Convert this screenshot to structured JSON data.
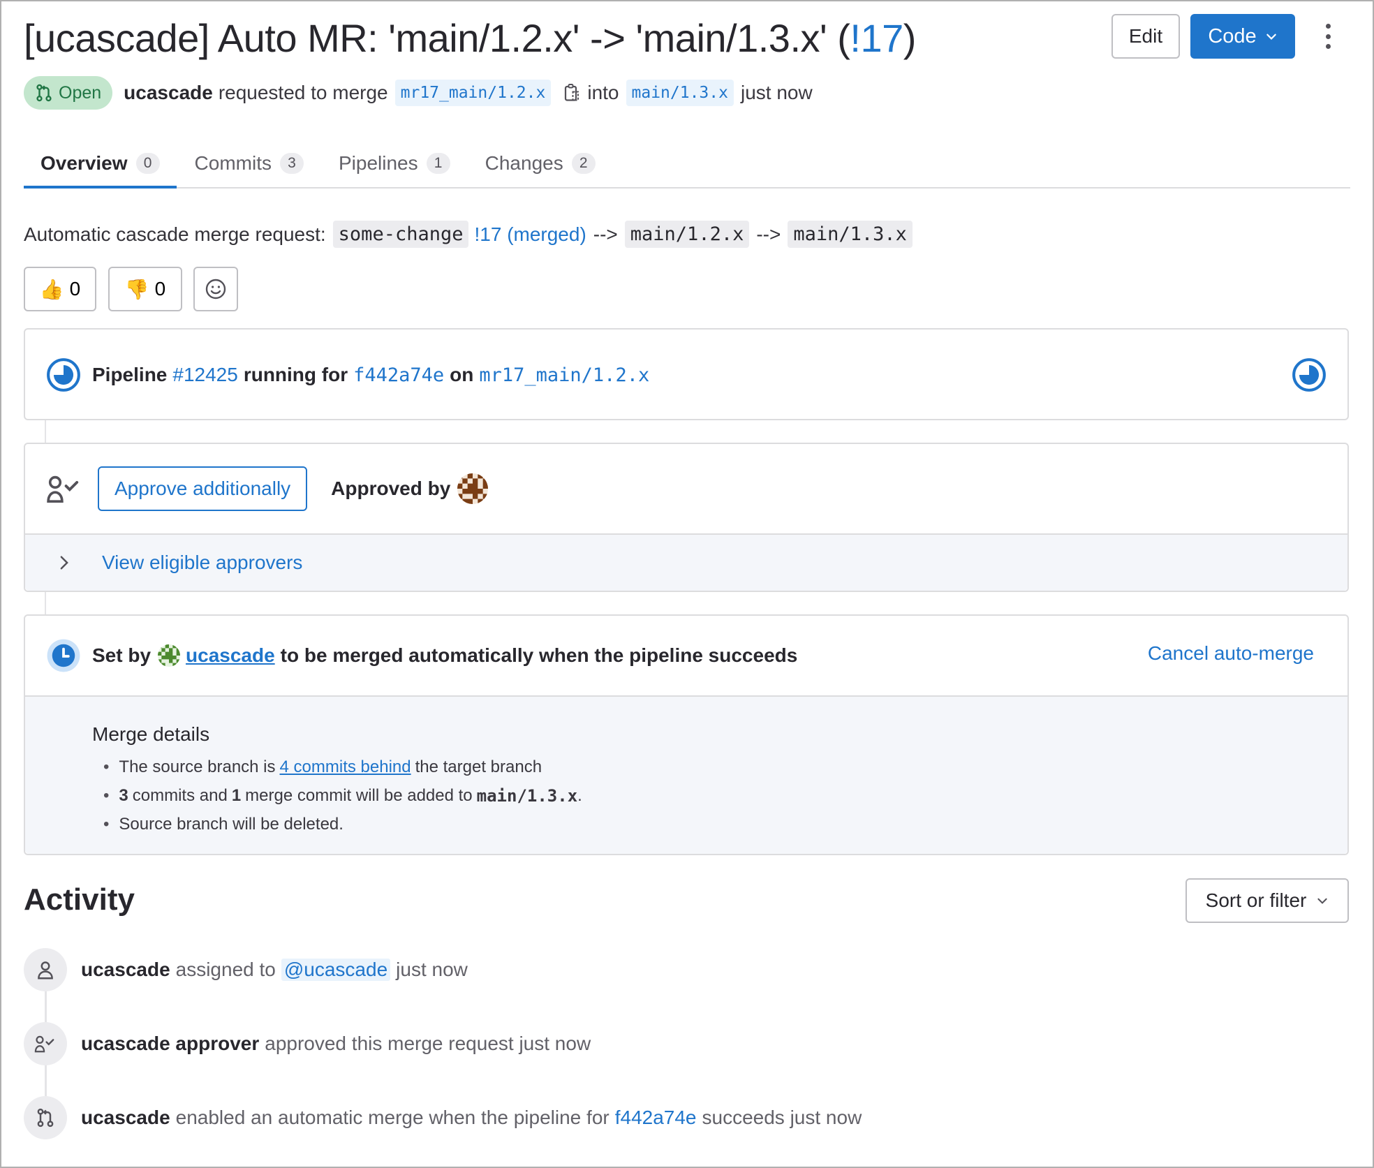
{
  "header": {
    "title_prefix": "[ucascade] Auto MR: 'main/1.2.x' -> 'main/1.3.x' (",
    "mr_number": "!17",
    "title_suffix": ")",
    "edit_label": "Edit",
    "code_label": "Code"
  },
  "meta": {
    "status": "Open",
    "author": "ucascade",
    "text_requested": "requested to merge",
    "source_branch": "mr17_main/1.2.x",
    "text_into": "into",
    "target_branch": "main/1.3.x",
    "time": "just now"
  },
  "tabs": [
    {
      "label": "Overview",
      "count": "0"
    },
    {
      "label": "Commits",
      "count": "3"
    },
    {
      "label": "Pipelines",
      "count": "1"
    },
    {
      "label": "Changes",
      "count": "2"
    }
  ],
  "description": {
    "prefix": "Automatic cascade merge request:",
    "code1": "some-change",
    "link": "!17 (merged)",
    "arrow1": "-->",
    "code2": "main/1.2.x",
    "arrow2": "-->",
    "code3": "main/1.3.x"
  },
  "reactions": {
    "thumbs_up": "0",
    "thumbs_down": "0"
  },
  "pipeline": {
    "label": "Pipeline",
    "id": "#12425",
    "running_for": "running for",
    "sha": "f442a74e",
    "on": "on",
    "branch": "mr17_main/1.2.x"
  },
  "approvals": {
    "approve_button": "Approve additionally",
    "approved_by": "Approved by",
    "view_eligible": "View eligible approvers"
  },
  "auto_merge": {
    "set_by": "Set by",
    "user": "ucascade",
    "message": "to be merged automatically when the pipeline succeeds",
    "cancel": "Cancel auto-merge",
    "details_title": "Merge details",
    "d1_prefix": "The source branch is",
    "d1_link": "4 commits behind",
    "d1_suffix": "the target branch",
    "d2_commits": "3",
    "d2_text1": "commits and",
    "d2_merge": "1",
    "d2_text2": "merge commit will be added to",
    "d2_branch": "main/1.3.x",
    "d2_end": ".",
    "d3": "Source branch will be deleted."
  },
  "activity": {
    "title": "Activity",
    "sort_label": "Sort or filter",
    "items": [
      {
        "user": "ucascade",
        "text": "assigned to",
        "mention": "@ucascade",
        "time": "just now"
      },
      {
        "user": "ucascade approver",
        "text": "approved this merge request just now"
      },
      {
        "user": "ucascade",
        "text": "enabled an automatic merge when the pipeline for",
        "sha": "f442a74e",
        "text2": "succeeds just now"
      }
    ]
  },
  "colors": {
    "accent": "#1f75cb",
    "open_badge_bg": "#c3e6cd",
    "open_badge_text": "#217645"
  }
}
